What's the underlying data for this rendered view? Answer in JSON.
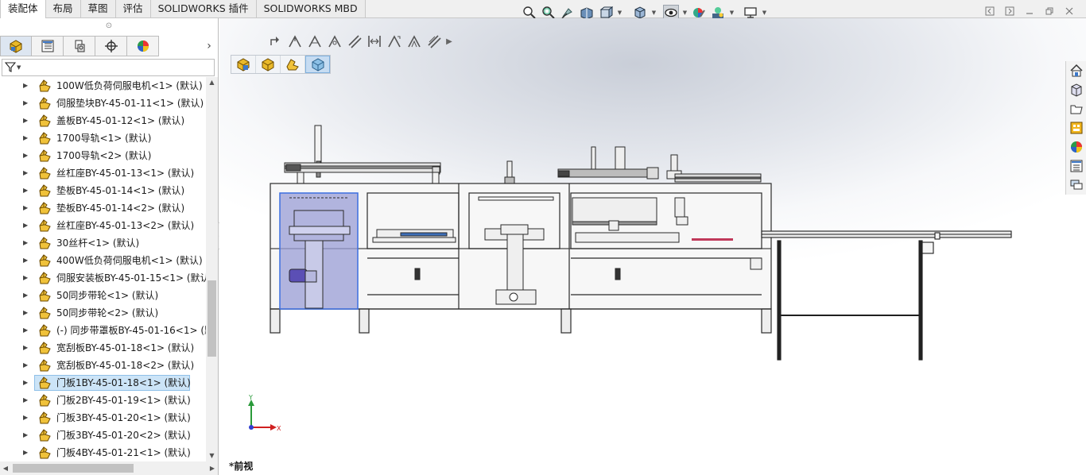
{
  "command_manager": {
    "tabs": [
      {
        "label": "装配体",
        "active": true
      },
      {
        "label": "布局",
        "active": false
      },
      {
        "label": "草图",
        "active": false
      },
      {
        "label": "评估",
        "active": false
      },
      {
        "label": "SOLIDWORKS 插件",
        "active": false
      },
      {
        "label": "SOLIDWORKS MBD",
        "active": false
      }
    ]
  },
  "heads_up_toolbar": {
    "icons": [
      "zoom-to-fit-icon",
      "zoom-to-area-icon",
      "previous-view-icon",
      "section-view-icon",
      "view-orientation-icon",
      "display-style-icon",
      "hide-show-items-icon",
      "edit-appearance-icon",
      "apply-scene-icon",
      "view-settings-icon"
    ]
  },
  "window_controls": {
    "icons": [
      "panel-restore-left-icon",
      "panel-restore-right-icon",
      "minimize-icon",
      "restore-icon",
      "close-icon"
    ]
  },
  "feature_manager": {
    "panel_tabs": [
      "featuremanager-tree-icon",
      "propertymanager-icon",
      "configurationmanager-icon",
      "dimxpertmanager-icon",
      "displaymanager-icon"
    ],
    "filter_icon": "filter-icon",
    "tree_items": [
      {
        "label": "100W低负荷伺服电机<1> (默认)",
        "selected": false
      },
      {
        "label": "伺服垫块BY-45-01-11<1> (默认)",
        "selected": false
      },
      {
        "label": "盖板BY-45-01-12<1> (默认)",
        "selected": false
      },
      {
        "label": "1700导轨<1> (默认)",
        "selected": false
      },
      {
        "label": "1700导轨<2> (默认)",
        "selected": false
      },
      {
        "label": "丝杠座BY-45-01-13<1> (默认)",
        "selected": false
      },
      {
        "label": "垫板BY-45-01-14<1> (默认)",
        "selected": false
      },
      {
        "label": "垫板BY-45-01-14<2> (默认)",
        "selected": false
      },
      {
        "label": "丝杠座BY-45-01-13<2> (默认)",
        "selected": false
      },
      {
        "label": "30丝杆<1> (默认)",
        "selected": false
      },
      {
        "label": "400W低负荷伺服电机<1> (默认)",
        "selected": false
      },
      {
        "label": "伺服安装板BY-45-01-15<1> (默认",
        "selected": false
      },
      {
        "label": "50同步带轮<1> (默认)",
        "selected": false
      },
      {
        "label": "50同步带轮<2> (默认)",
        "selected": false
      },
      {
        "label": "(-) 同步带罩板BY-45-01-16<1> (默",
        "selected": false
      },
      {
        "label": "宽刮板BY-45-01-18<1> (默认)",
        "selected": false
      },
      {
        "label": "宽刮板BY-45-01-18<2> (默认)",
        "selected": false
      },
      {
        "label": "门板1BY-45-01-18<1> (默认)",
        "selected": true
      },
      {
        "label": "门板2BY-45-01-19<1> (默认)",
        "selected": false
      },
      {
        "label": "门板3BY-45-01-20<1> (默认)",
        "selected": false
      },
      {
        "label": "门板3BY-45-01-20<2> (默认)",
        "selected": false
      },
      {
        "label": "门板4BY-45-01-21<1> (默认)",
        "selected": false
      }
    ]
  },
  "context_toolbar": {
    "icons": [
      "redo-arrow-icon",
      "constraint-angle-icon",
      "constraint-angle-icon",
      "constraint-angle-icon",
      "constraint-parallel-icon",
      "constraint-distance-icon",
      "constraint-angle-icon",
      "constraint-angle-icon",
      "constraint-parallel-icon"
    ]
  },
  "selection_filter": {
    "icons": [
      "filter-components-icon",
      "filter-subassembly-icon",
      "filter-toolbox-icon",
      "filter-solid-icon"
    ]
  },
  "task_pane": {
    "icons": [
      "home-icon",
      "design-library-icon",
      "file-explorer-icon",
      "view-palette-icon",
      "appearances-icon",
      "custom-properties-icon",
      "forum-icon"
    ]
  },
  "triad": {
    "x_label": "X",
    "y_label": "Y"
  },
  "view": {
    "name": "*前视"
  },
  "colors": {
    "selection_fill": "#9a9ed6",
    "motor_purple": "#5b4fb5",
    "accent_red": "#c0395a"
  }
}
